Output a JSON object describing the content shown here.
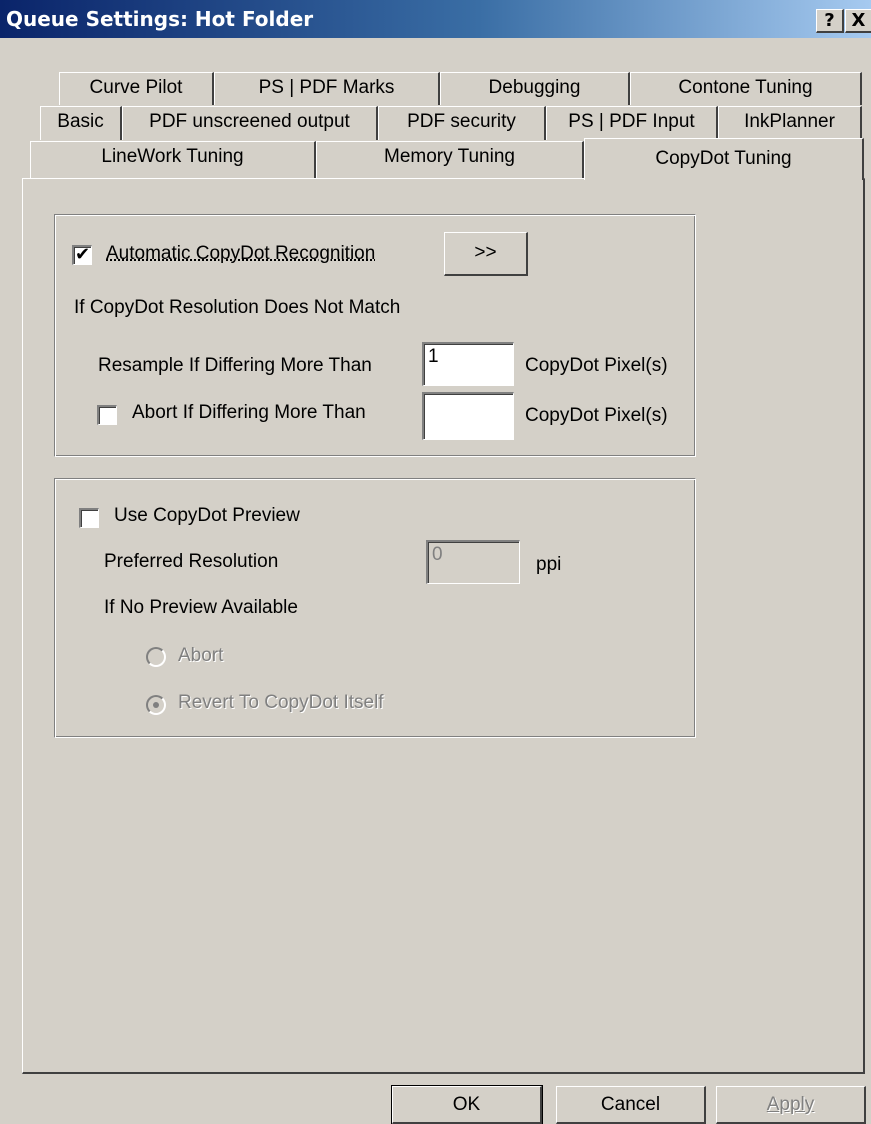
{
  "window": {
    "title": "Queue Settings: Hot Folder",
    "help_button": "?",
    "close_button": "X"
  },
  "tabs": {
    "row1": [
      "Curve Pilot",
      "PS | PDF Marks",
      "Debugging",
      "Contone Tuning"
    ],
    "row2": [
      "Basic",
      "PDF unscreened output",
      "PDF security",
      "PS | PDF Input",
      "InkPlanner"
    ],
    "row3": [
      "LineWork Tuning",
      "Memory Tuning",
      "CopyDot Tuning"
    ],
    "selected": "CopyDot Tuning"
  },
  "recognition": {
    "auto_checkbox_checked": true,
    "auto_label": "Automatic CopyDot Recognition",
    "more_button": ">>",
    "mismatch_label": "If CopyDot Resolution Does Not Match",
    "resample_label": "Resample If Differing More Than",
    "resample_value": "1",
    "resample_unit": "CopyDot Pixel(s)",
    "abort_checkbox_checked": false,
    "abort_label": "Abort If Differing More Than",
    "abort_value": "",
    "abort_unit": "CopyDot Pixel(s)"
  },
  "preview": {
    "use_checkbox_checked": false,
    "use_label": "Use CopyDot Preview",
    "resolution_label": "Preferred Resolution",
    "resolution_value": "0",
    "resolution_unit": "ppi",
    "no_preview_label": "If No Preview Available",
    "options": [
      "Abort",
      "Revert To CopyDot Itself"
    ],
    "selected_option": "Revert To CopyDot Itself"
  },
  "footer": {
    "ok": "OK",
    "cancel": "Cancel",
    "apply": "Apply"
  }
}
